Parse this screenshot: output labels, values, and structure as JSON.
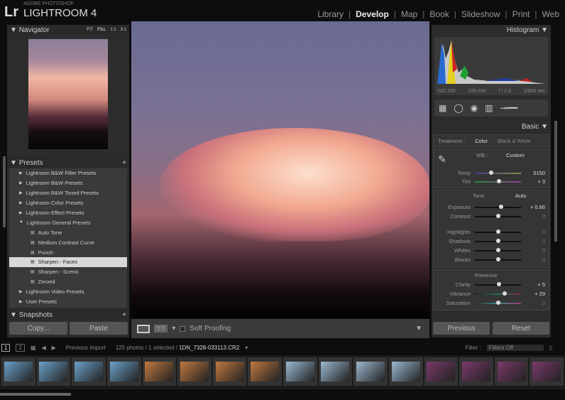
{
  "app": {
    "logo_mark": "Lr",
    "brand_small": "ADOBE PHOTOSHOP",
    "brand": "LIGHTROOM 4"
  },
  "modules": [
    {
      "label": "Library"
    },
    {
      "label": "Develop",
      "active": true
    },
    {
      "label": "Map"
    },
    {
      "label": "Book"
    },
    {
      "label": "Slideshow"
    },
    {
      "label": "Print"
    },
    {
      "label": "Web"
    }
  ],
  "navigator": {
    "title": "Navigator",
    "zooms": [
      "FIT",
      "FILL",
      "1:1",
      "3:1"
    ],
    "active_zoom": "FILL"
  },
  "presets": {
    "title": "Presets",
    "items": [
      {
        "label": "Lightroom B&W Filter Presets",
        "type": "folder"
      },
      {
        "label": "Lightroom B&W Presets",
        "type": "folder"
      },
      {
        "label": "Lightroom B&W Toned Presets",
        "type": "folder"
      },
      {
        "label": "Lightroom Color Presets",
        "type": "folder"
      },
      {
        "label": "Lightroom Effect Presets",
        "type": "folder"
      },
      {
        "label": "Lightroom General Presets",
        "type": "folder-open"
      },
      {
        "label": "Auto Tone",
        "type": "preset"
      },
      {
        "label": "Medium Contrast Curve",
        "type": "preset"
      },
      {
        "label": "Punch",
        "type": "preset"
      },
      {
        "label": "Sharpen - Faces",
        "type": "preset",
        "selected": true
      },
      {
        "label": "Sharpen - Scenic",
        "type": "preset"
      },
      {
        "label": "Zeroed",
        "type": "preset"
      },
      {
        "label": "Lightroom Video Presets",
        "type": "folder"
      },
      {
        "label": "User Presets",
        "type": "folder"
      }
    ]
  },
  "snapshots": {
    "title": "Snapshots"
  },
  "left_buttons": {
    "copy": "Copy...",
    "paste": "Paste"
  },
  "toolbar": {
    "soft_proofing": "Soft Proofing",
    "before_after": "YY"
  },
  "histogram": {
    "title": "Histogram",
    "iso": "ISO 200",
    "focal": "155 mm",
    "aperture": "f / 2.8",
    "shutter": "1/800 sec"
  },
  "basic": {
    "title": "Basic",
    "treatment_label": "Treatment :",
    "color": "Color",
    "bw": "Black & White",
    "wb_label": "WB :",
    "wb_value": "Custom",
    "tone_label": "Tone",
    "auto": "Auto",
    "presence_label": "Presence",
    "sliders": [
      {
        "label": "Temp",
        "value": "5150",
        "pos": 0.35
      },
      {
        "label": "Tint",
        "value": "+ 3",
        "pos": 0.52
      },
      {
        "label": "Exposure",
        "value": "+ 0.66",
        "pos": 0.57
      },
      {
        "label": "Contrast",
        "value": "0",
        "pos": 0.5
      },
      {
        "label": "Highlights",
        "value": "0",
        "pos": 0.5
      },
      {
        "label": "Shadows",
        "value": "0",
        "pos": 0.5
      },
      {
        "label": "Whites",
        "value": "0",
        "pos": 0.5
      },
      {
        "label": "Blacks",
        "value": "0",
        "pos": 0.5
      },
      {
        "label": "Clarity",
        "value": "+ 5",
        "pos": 0.53
      },
      {
        "label": "Vibrance",
        "value": "+ 29",
        "pos": 0.65
      },
      {
        "label": "Saturation",
        "value": "0",
        "pos": 0.5
      }
    ]
  },
  "right_buttons": {
    "previous": "Previous",
    "reset": "Reset"
  },
  "filmstrip": {
    "screen1": "1",
    "screen2": "2",
    "source": "Previous Import",
    "count": "125 photos / 1 selected /",
    "filename": "1DN_7328-033113.CR2",
    "filter_label": "Filter :",
    "filter_value": "Filters Off",
    "thumbs": [
      "#6aa0c8",
      "#6aa0c8",
      "#6aa0c8",
      "#6aa0c8",
      "#c07840",
      "#c07840",
      "#c07840",
      "#c07840",
      "#9ab8d0",
      "#9ab8d0",
      "#9ab8d0",
      "#9ab8d0",
      "#7a3a6a",
      "#7a3a6a",
      "#7a3a6a",
      "#7a3a6a"
    ]
  }
}
